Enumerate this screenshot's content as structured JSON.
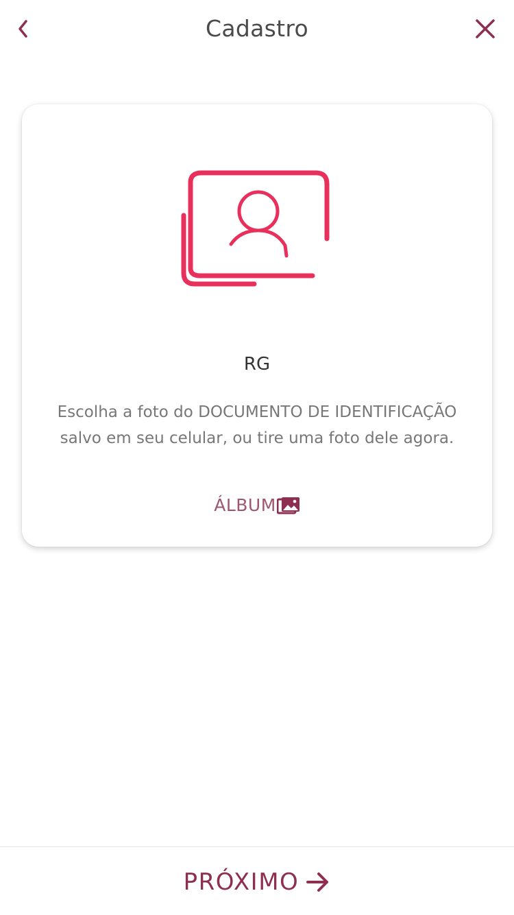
{
  "header": {
    "title": "Cadastro",
    "back_icon": "chevron-left-icon",
    "close_icon": "close-icon"
  },
  "card": {
    "illustration_icon": "id-document-photo-icon",
    "title": "RG",
    "description": "Escolha a foto do DOCUMENTO DE IDENTIFICAÇÃO salvo em seu celular, ou tire uma foto dele agora.",
    "album_label": "ÁLBUM",
    "album_icon": "photo-album-icon"
  },
  "footer": {
    "next_label": "PRÓXIMO",
    "next_icon": "arrow-right-icon"
  },
  "colors": {
    "brand": "#8e2f52",
    "accent_pink": "#e8305c",
    "album_text": "#a0576e",
    "title_text": "#4a4a4a",
    "body_text": "#777777"
  }
}
